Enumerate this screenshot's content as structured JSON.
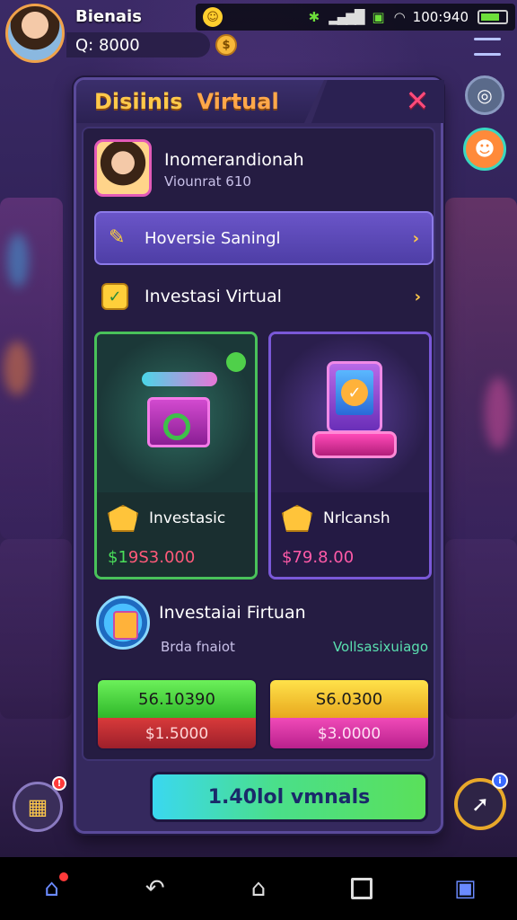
{
  "status_bar": {
    "time": "100:940",
    "emoji_icon": "smile-emoji-icon",
    "network_icon": "network-icon",
    "signal_icon": "signal-icon",
    "wifi_icon": "wifi-icon",
    "battery_icon": "battery-icon"
  },
  "player": {
    "name": "Bienais",
    "balance": "Q: 8000"
  },
  "panel": {
    "title_a": "Disiinis",
    "title_b": "Virtual",
    "close_label": "✕",
    "profile": {
      "name": "Inomerandionah",
      "subtitle": "Viounrat  610"
    },
    "row1_label": "Hoversie Saningl",
    "section_label": "Investasi Virtual",
    "cards": [
      {
        "title": "Investasic",
        "price_prefix": "$1",
        "price": "9S3.000",
        "accent": "#49c25a"
      },
      {
        "title": "Nrlcansh",
        "price_prefix": "$",
        "price": "79.8.00",
        "accent": "#7a58d8"
      }
    ],
    "investasi": {
      "title": "Investaiai Firtuan",
      "sub_left": "Brda fnaiot",
      "sub_right": "Vollsasixuiago"
    },
    "buttons": [
      {
        "top": "56.10390",
        "bottom": "$1.5000"
      },
      {
        "top": "S6.0300",
        "bottom": "$3.0000"
      }
    ],
    "cta_label": "1.40lol vmnals"
  },
  "colors": {
    "panel_bg": "#35295e",
    "accent_gold": "#ffc94a",
    "green": "#49c25a",
    "purple": "#7a58d8"
  }
}
